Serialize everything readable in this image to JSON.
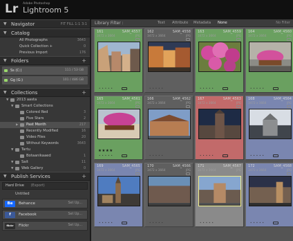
{
  "app": {
    "brand_top": "Adobe Photoshop",
    "name": "Lightroom 5",
    "mark": "Lr"
  },
  "left": {
    "navigator": {
      "title": "Navigator",
      "zoom_options": "FIT  FILL  1:1  3:1"
    },
    "catalog": {
      "title": "Catalog",
      "items": [
        {
          "label": "All Photographs",
          "count": "3643"
        },
        {
          "label": "Quick Collection +",
          "count": "0"
        },
        {
          "label": "Previous Import",
          "count": "176"
        }
      ]
    },
    "folders": {
      "title": "Folders",
      "drives": [
        {
          "label": "Ss (C:)",
          "count": "111 / 53 GB"
        },
        {
          "label": "Gg (G:)",
          "count": "101 / 486 GB"
        }
      ]
    },
    "collections": {
      "title": "Collections",
      "items": [
        {
          "label": "2013 aasta",
          "count": "",
          "indent": 0
        },
        {
          "label": "Smart Collections",
          "count": "",
          "indent": 1
        },
        {
          "label": "Colored Red",
          "count": "3",
          "indent": 2
        },
        {
          "label": "Five Stars",
          "count": "2",
          "indent": 2
        },
        {
          "label": "Past Month",
          "count": "217",
          "indent": 2,
          "selected": true
        },
        {
          "label": "Recently Modified",
          "count": "16",
          "indent": 2
        },
        {
          "label": "Video Files",
          "count": "20",
          "indent": 2
        },
        {
          "label": "Without Keywords",
          "count": "3643",
          "indent": 2
        },
        {
          "label": "Tartu",
          "count": "",
          "indent": 1
        },
        {
          "label": "Botaanikaaed",
          "count": "1",
          "indent": 2
        },
        {
          "label": "Sait",
          "count": "11",
          "indent": 1
        },
        {
          "label": "Web Gallery",
          "count": "0",
          "indent": 1
        }
      ]
    },
    "publish": {
      "title": "Publish Services",
      "hard_drive_tab": "Hard Drive",
      "hard_drive_sub": "(Export)",
      "unsaved": "Untitled",
      "services": [
        {
          "label": "Behance",
          "logo": "Be",
          "setup": "Set Up...",
          "color": "#1769ff"
        },
        {
          "label": "Facebook",
          "logo": "f",
          "setup": "Set Up...",
          "color": "#3b5998"
        },
        {
          "label": "Flickr",
          "logo": "flickr",
          "setup": "Set Up...",
          "color": "#2e2e2e"
        }
      ]
    }
  },
  "main": {
    "filter": {
      "title": "Library Filter :",
      "tabs": [
        "Text",
        "Attribute",
        "Metadata",
        "None"
      ],
      "active_tab": "None",
      "right": "No Filter"
    },
    "cells": [
      {
        "num": "161",
        "file": "SAM_4557",
        "dims": "3472 x 3664",
        "ext": "JPG",
        "label": "#6aa060",
        "scene": "street-day"
      },
      {
        "num": "162",
        "file": "SAM_4558",
        "dims": "3472 x 3664",
        "ext": "JPG",
        "label": "",
        "scene": "street-orange"
      },
      {
        "num": "163",
        "file": "SAM_4559",
        "dims": "3472 x 3664",
        "ext": "JPG",
        "label": "#6aa060",
        "scene": "flowers"
      },
      {
        "num": "164",
        "file": "SAM_4560",
        "dims": "3472 x 3664",
        "ext": "JPG",
        "label": "#6aa060",
        "scene": "flowerbox"
      },
      {
        "num": "165",
        "file": "SAM_4561",
        "dims": "3472 x 3664",
        "ext": "JPG",
        "label": "#6aa060",
        "scene": "flowers-2",
        "stars": 4
      },
      {
        "num": "166",
        "file": "SAM_4562",
        "dims": "3472 x 3664",
        "ext": "JPG",
        "label": "",
        "scene": "building"
      },
      {
        "num": "167",
        "file": "SAM_4563",
        "dims": "3472 x 3664",
        "ext": "JPG",
        "label": "#c26a6a",
        "scene": "tower-red"
      },
      {
        "num": "168",
        "file": "SAM_4564",
        "dims": "3472 x 3664",
        "ext": "JPG",
        "label": "#7a86b0",
        "scene": "church"
      },
      {
        "num": "169",
        "file": "SAM_4565",
        "dims": "3472 x 3664",
        "ext": "JPG",
        "label": "#7a86b0",
        "scene": "spire"
      },
      {
        "num": "170",
        "file": "SAM_4566",
        "dims": "3472 x 3664",
        "ext": "JPG",
        "label": "",
        "scene": "facade"
      },
      {
        "num": "171",
        "file": "SAM_4567",
        "dims": "3472 x 3664",
        "ext": "JPG",
        "label": "",
        "scene": "square",
        "selected": true
      },
      {
        "num": "172",
        "file": "SAM_4568",
        "dims": "3472 x 3664",
        "ext": "JPG",
        "label": "#7a86b0",
        "scene": "square-2"
      }
    ]
  }
}
